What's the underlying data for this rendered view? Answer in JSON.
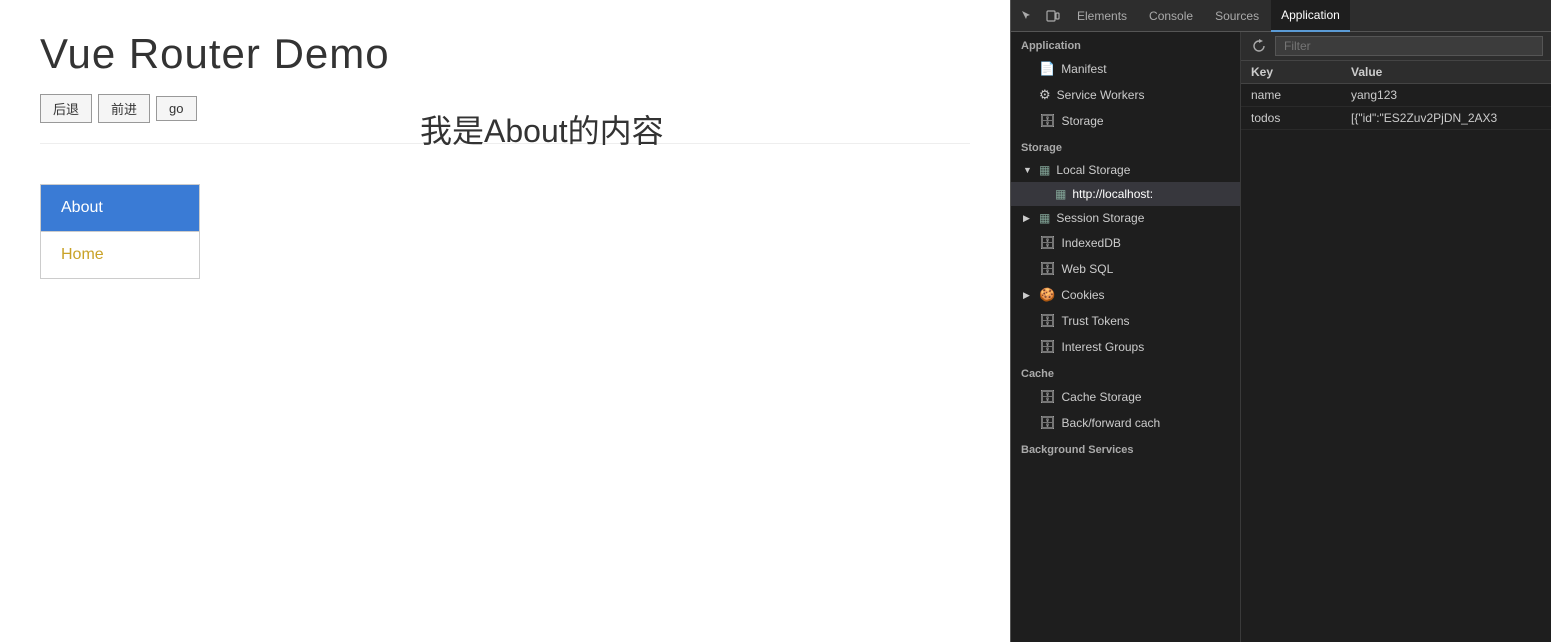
{
  "app": {
    "title": "Vue Router Demo",
    "nav_buttons": [
      "后退",
      "前进",
      "go"
    ],
    "links": [
      {
        "label": "About",
        "active": true
      },
      {
        "label": "Home",
        "active": false
      }
    ],
    "content": "我是About的内容"
  },
  "devtools": {
    "tabs": [
      "Elements",
      "Console",
      "Sources",
      "Application"
    ],
    "active_tab": "Application",
    "filter_placeholder": "Filter",
    "sidebar": {
      "app_section": "Application",
      "app_items": [
        {
          "label": "Manifest",
          "icon": "📄",
          "type": "file"
        },
        {
          "label": "Service Workers",
          "icon": "⚙",
          "type": "gear"
        },
        {
          "label": "Storage",
          "icon": "🗄",
          "type": "db"
        }
      ],
      "storage_section": "Storage",
      "storage_items": [
        {
          "label": "Local Storage",
          "icon": "▦",
          "expandable": true,
          "expanded": true
        },
        {
          "label": "http://localhost:",
          "icon": "▦",
          "indent": 2,
          "selected": true
        },
        {
          "label": "Session Storage",
          "icon": "▦",
          "expandable": true,
          "expanded": false
        },
        {
          "label": "IndexedDB",
          "icon": "🗄"
        },
        {
          "label": "Web SQL",
          "icon": "🗄"
        },
        {
          "label": "Cookies",
          "icon": "🍪",
          "expandable": true
        },
        {
          "label": "Trust Tokens",
          "icon": "🗄"
        },
        {
          "label": "Interest Groups",
          "icon": "🗄"
        }
      ],
      "cache_section": "Cache",
      "cache_items": [
        {
          "label": "Cache Storage",
          "icon": "🗄"
        },
        {
          "label": "Back/forward cach",
          "icon": "🗄"
        }
      ],
      "bg_section": "Background Services"
    },
    "table": {
      "headers": [
        "Key",
        "Value"
      ],
      "rows": [
        {
          "key": "name",
          "value": "yang123"
        },
        {
          "key": "todos",
          "value": "[{\"id\":\"ES2Zuv2PjDN_2AX3"
        }
      ]
    }
  }
}
